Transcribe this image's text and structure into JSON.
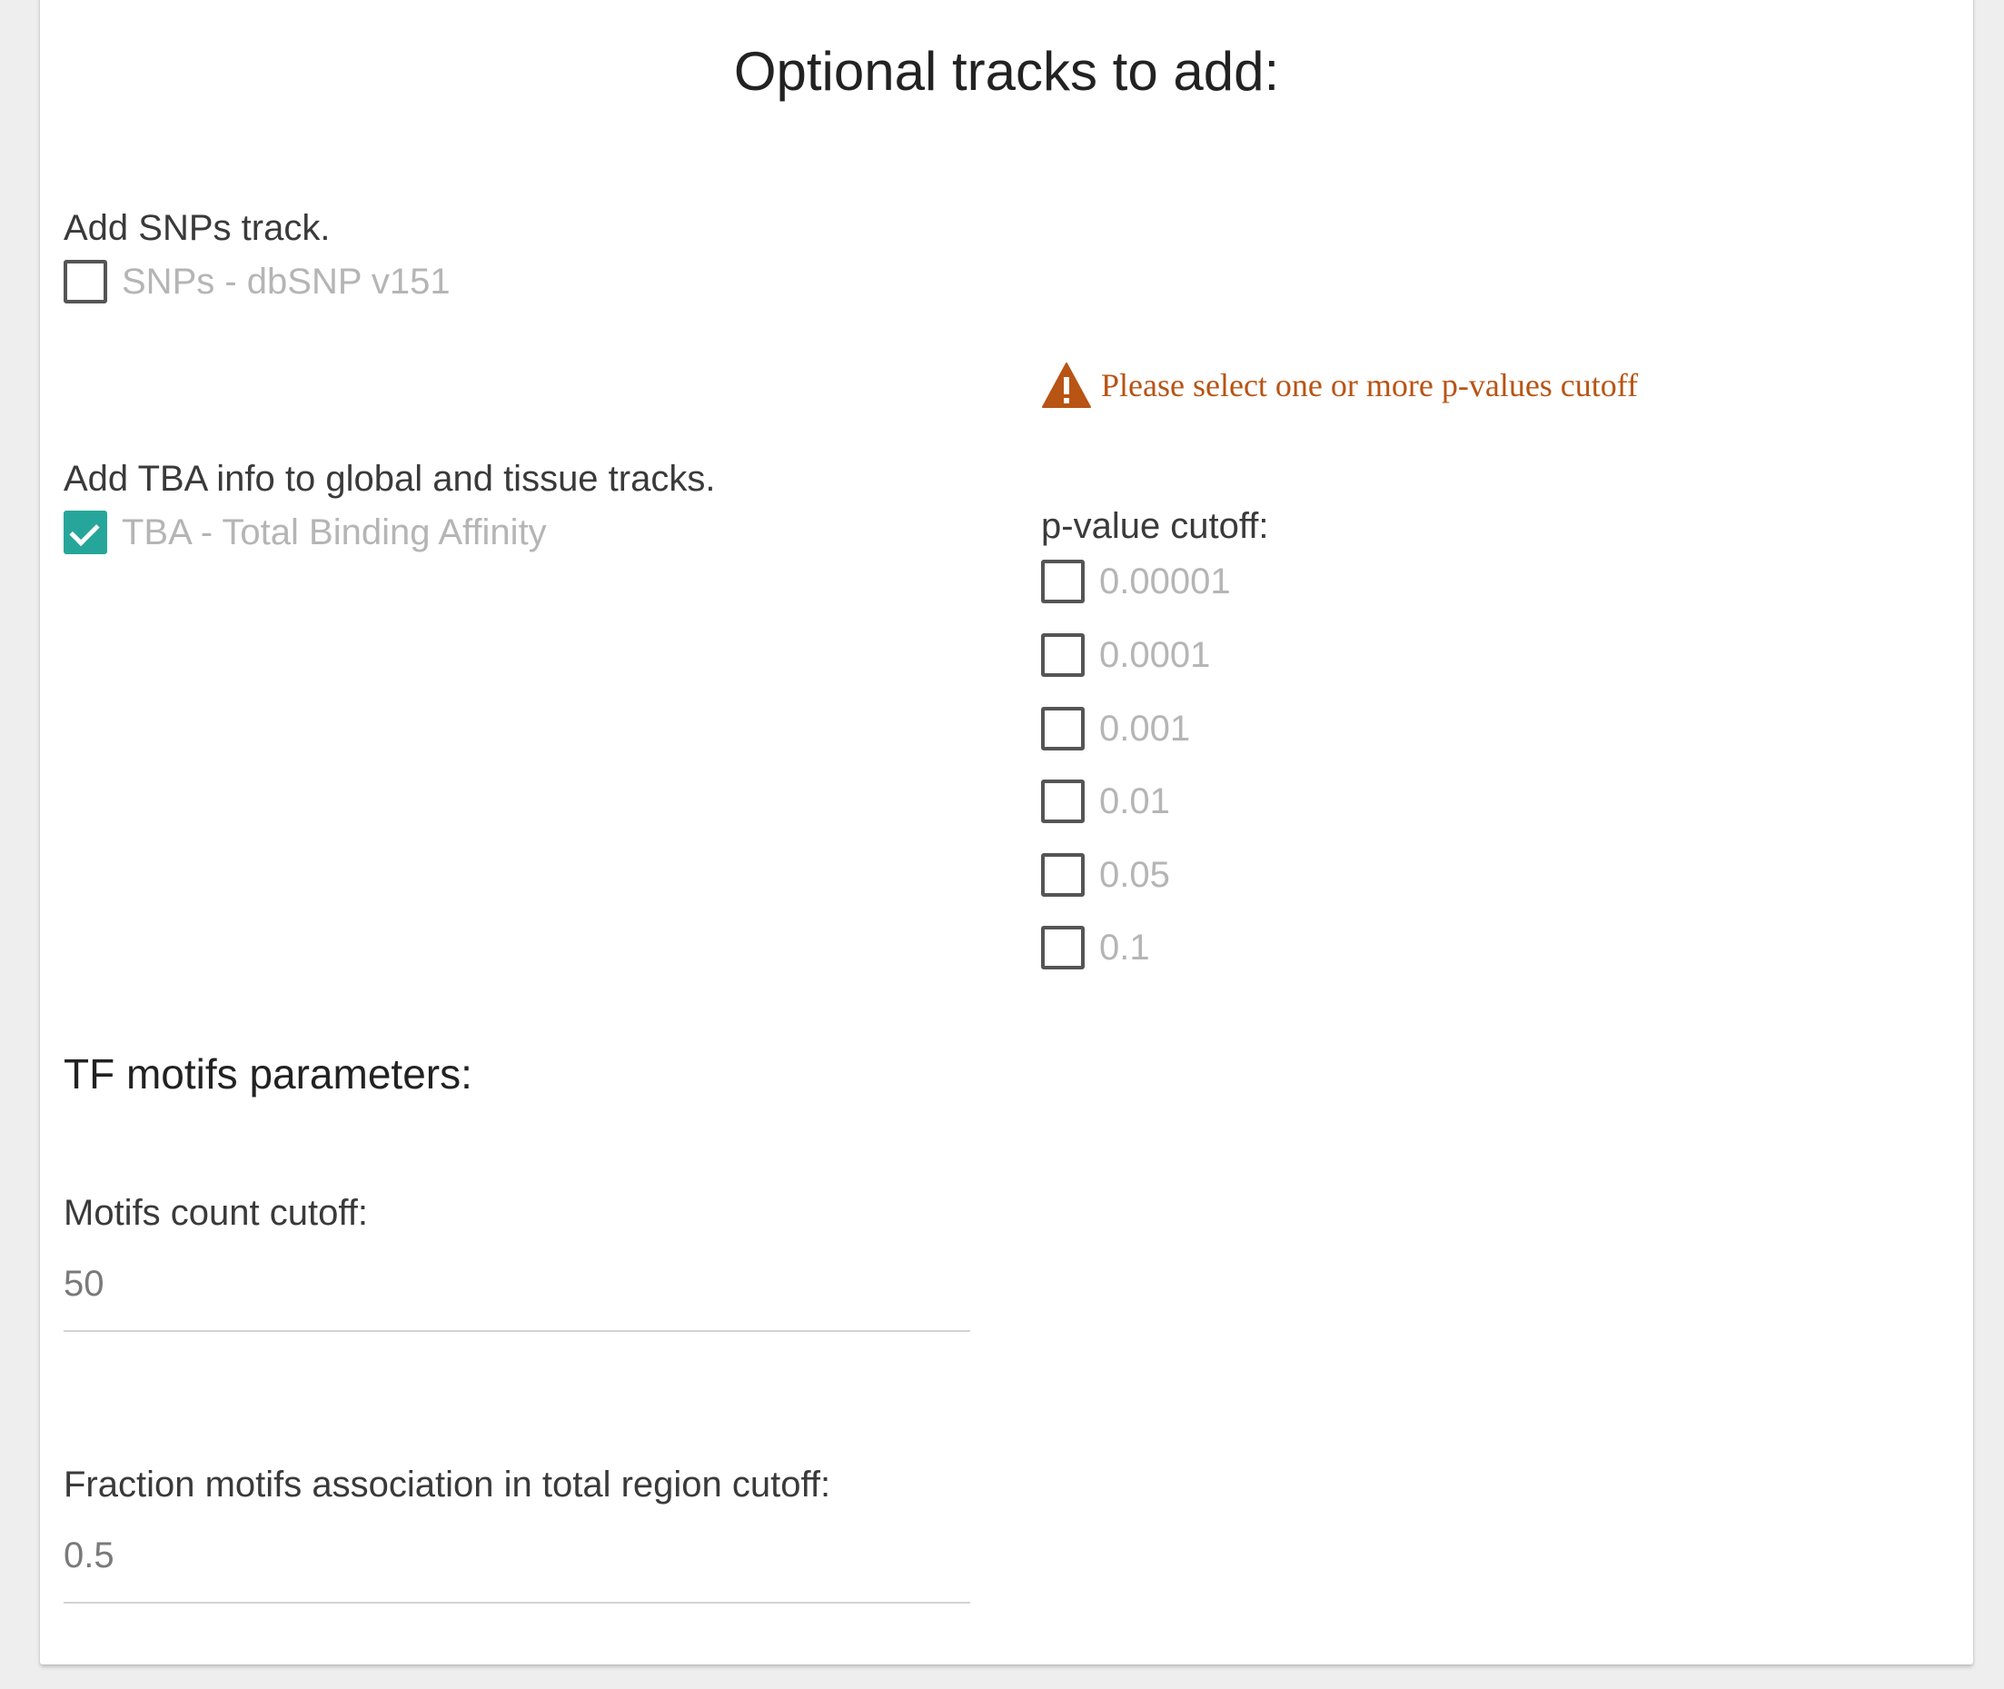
{
  "header": {
    "title": "Optional tracks to add:"
  },
  "snps": {
    "label": "Add SNPs track.",
    "option_label": "SNPs - dbSNP v151",
    "checked": false
  },
  "tba": {
    "label": "Add TBA info to global and tissue tracks.",
    "option_label": "TBA - Total Binding Affinity",
    "checked": true
  },
  "warning": {
    "text": "Please select one or more p-values cutoff",
    "icon": "warning-icon",
    "color": "#b85414"
  },
  "pvalue": {
    "label": "p-value cutoff:",
    "options": [
      {
        "label": "0.00001",
        "checked": false
      },
      {
        "label": "0.0001",
        "checked": false
      },
      {
        "label": "0.001",
        "checked": false
      },
      {
        "label": "0.01",
        "checked": false
      },
      {
        "label": "0.05",
        "checked": false
      },
      {
        "label": "0.1",
        "checked": false
      }
    ]
  },
  "tf_motifs": {
    "section_label": "TF motifs parameters:",
    "count_cutoff": {
      "label": "Motifs count cutoff:",
      "value": "50"
    },
    "fraction_cutoff": {
      "label": "Fraction motifs association in total region cutoff:",
      "value": "0.5"
    }
  },
  "colors": {
    "accent": "#26a69a",
    "checkbox_border": "#555555",
    "option_text": "#b5b5b5"
  }
}
